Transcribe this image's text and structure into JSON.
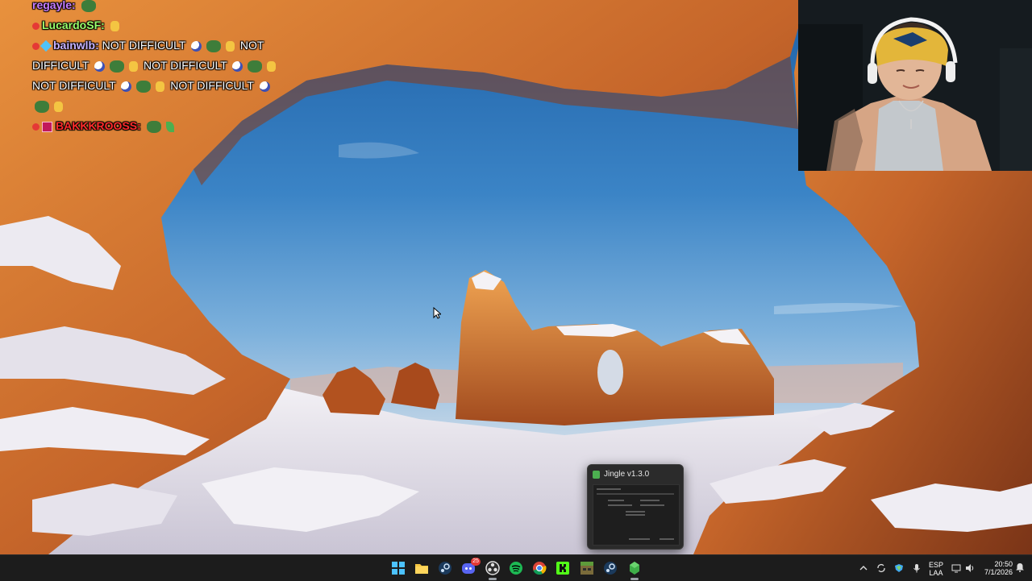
{
  "chat": {
    "lines": [
      {
        "user": "regayle:",
        "text": ""
      },
      {
        "user": "LucardoSF:",
        "text": ""
      },
      {
        "user": "bainwlb:",
        "text": "NOT DIFFICULT"
      },
      {
        "text": "NOT DIFFICULT"
      },
      {
        "text": "DIFFICULT"
      },
      {
        "text": "NOT DIFFICULT"
      },
      {
        "text": "NOT DIFFICULT"
      },
      {
        "text": "NOT DIFFICULT"
      },
      {
        "text": "NOT DIFFICULT"
      },
      {
        "user": "BAKKKROOSS:",
        "text": ""
      }
    ],
    "colors": {
      "regayle": "#c77dff",
      "lucardo": "#9cff6b",
      "bainwlb": "#c7b3ff",
      "bakk": "#ff2b2b"
    }
  },
  "jingle": {
    "title": "Jingle v1.3.0"
  },
  "taskbar": {
    "icons": [
      "windows-start-icon",
      "file-explorer-icon",
      "steam-icon",
      "discord-icon",
      "obs-icon",
      "spotify-icon",
      "chrome-icon",
      "kick-icon",
      "minecraft-launcher-icon",
      "steam-icon-2",
      "jingle-icon"
    ],
    "discord_badge": "25",
    "lang_top": "ESP",
    "lang_bottom": "LAA",
    "time": "20:50",
    "date": "7/1/2026"
  }
}
